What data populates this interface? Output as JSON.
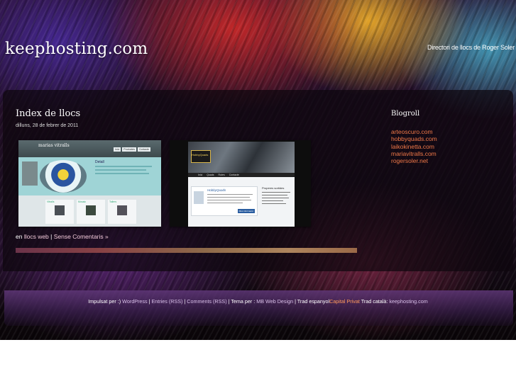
{
  "header": {
    "site_title": "keephosting.com",
    "tagline": "Directori de llocs de Roger Soler"
  },
  "post": {
    "title": "Index de llocs",
    "date": "dilluns, 28 de febrer de 2011",
    "meta_prefix": "en ",
    "category": "llocs web",
    "separator": " | ",
    "comments": "Sense Comentaris »"
  },
  "shots": {
    "one": {
      "site_name": "marias vitralls",
      "buttons": [
        "Inici",
        "Productes",
        "Contacte"
      ],
      "heading": "Detall",
      "thumbs": [
        "Vitralls",
        "Mosaic",
        "Tallers"
      ]
    },
    "two": {
      "logo": "HobbyQuads",
      "menu": [
        "Inici",
        "Quads",
        "Rutes",
        "Contacte"
      ],
      "box_title": "HobbyQuads",
      "box_button": "Més informació",
      "side_title": "Properes sortides"
    }
  },
  "sidebar": {
    "title": "Blogroll",
    "links": [
      "arteoscuro.com",
      "hobbyquads.com",
      "laikokinetta.com",
      "mariavitralls.com",
      "rogersoler.net"
    ]
  },
  "footer": {
    "powered": "Impulsat per :) ",
    "wordpress": "WordPress",
    "sep": " | ",
    "entries": "Entries (RSS)",
    "comments": "Comments (RSS)",
    "theme_prefix": " | Tema per : ",
    "theme_author": "MB Web Design",
    "trad_es": " | Trad espanyol",
    "capital": "Capital Privat",
    "trad_ca": " Trad català: ",
    "keephosting": "keephosting.com"
  },
  "colors": {
    "link_orange": "#f07848",
    "footer_link": "#d8c0e8",
    "panel": "#0e070e"
  }
}
